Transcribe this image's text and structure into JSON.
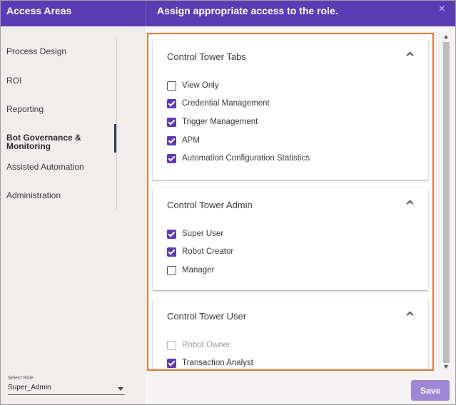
{
  "colors": {
    "header": "#5b3cb5",
    "accent_border": "#e8742c",
    "save": "#9d87d6"
  },
  "header": {
    "left_title": "Access Areas",
    "right_title": "Assign appropriate access to the role.",
    "close_glyph": "×"
  },
  "sidebar": {
    "items": [
      {
        "label": "Process Design"
      },
      {
        "label": "ROI"
      },
      {
        "label": "Reporting"
      },
      {
        "label": "Bot Governance &",
        "label2": "Monitoring",
        "active": true
      },
      {
        "label": "Assisted Automation"
      },
      {
        "label": "Administration"
      }
    ],
    "role": {
      "label": "Select Role",
      "value": "Super_Admin"
    }
  },
  "cards": [
    {
      "title": "Control Tower Tabs",
      "options": [
        {
          "label": "View Only",
          "checked": false
        },
        {
          "label": "Credential Management",
          "checked": true
        },
        {
          "label": "Trigger Management",
          "checked": true
        },
        {
          "label": "APM",
          "checked": true
        },
        {
          "label": "Automation Configuration Statistics",
          "checked": true
        }
      ]
    },
    {
      "title": "Control Tower Admin",
      "options": [
        {
          "label": "Super User",
          "checked": true
        },
        {
          "label": "Robot Creator",
          "checked": true
        },
        {
          "label": "Manager",
          "checked": false
        }
      ]
    },
    {
      "title": "Control Tower User",
      "options": [
        {
          "label": "Robot Owner",
          "checked": false,
          "disabled": true
        },
        {
          "label": "Transaction Analyst",
          "checked": true
        }
      ]
    }
  ],
  "actions": {
    "save_label": "Save"
  }
}
